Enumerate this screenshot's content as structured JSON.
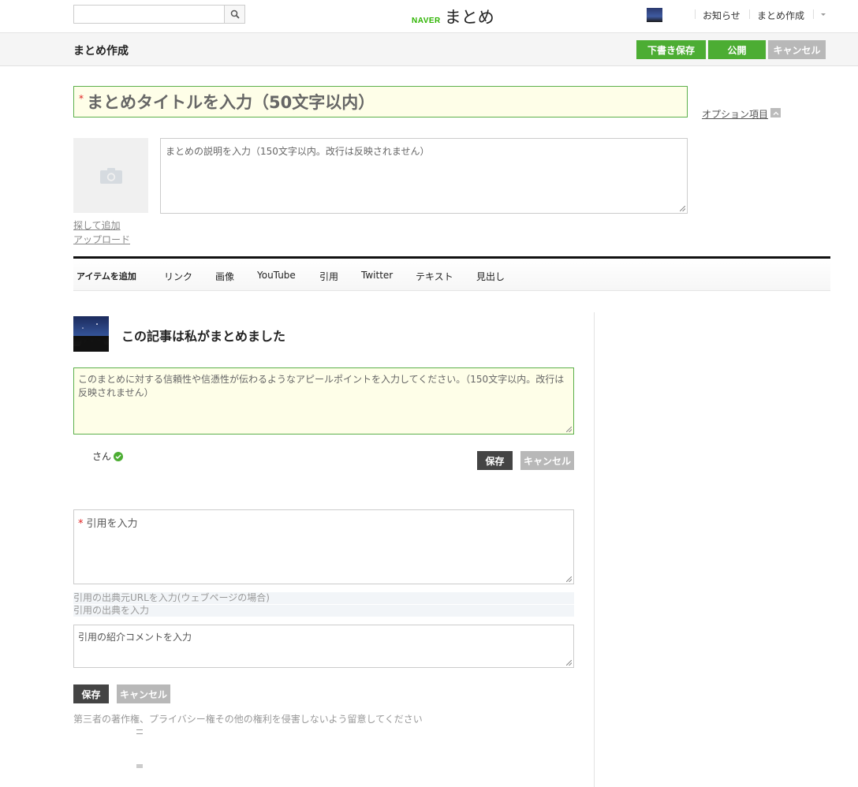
{
  "header": {
    "search_placeholder": "",
    "logo_brand": "NAVER",
    "logo_service": "まとめ",
    "links": [
      "お知らせ",
      "まとめ作成"
    ]
  },
  "subheader": {
    "title": "まとめ作成",
    "draft_label": "下書き保存",
    "publish_label": "公開",
    "cancel_label": "キャンセル"
  },
  "editor": {
    "required_mark": "*",
    "title_placeholder": "まとめタイトルを入力（50文字以内）",
    "option_label": "オプション項目",
    "description_placeholder": "まとめの説明を入力（150文字以内。改行は反映されません）",
    "search_add": "探して追加",
    "upload": "アップロード"
  },
  "items_toolbar": {
    "label": "アイテムを追加",
    "tabs": [
      "リンク",
      "画像",
      "YouTube",
      "引用",
      "Twitter",
      "テキスト",
      "見出し"
    ]
  },
  "curator": {
    "heading": "この記事は私がまとめました",
    "appeal_placeholder": "このまとめに対する信頼性や信憑性が伝わるようなアピールポイントを入力してください。（150文字以内。改行は反映されません）",
    "name_suffix": "さん",
    "save_label": "保存",
    "cancel_label": "キャンセル"
  },
  "quote": {
    "required_mark": "*",
    "quote_placeholder": "引用を入力",
    "url_placeholder": "引用の出典元URLを入力(ウェブページの場合)",
    "source_placeholder": "引用の出典を入力",
    "comment_placeholder": "引用の紹介コメントを入力",
    "save_label": "保存",
    "cancel_label": "キャンセル",
    "notice": "第三者の著作権、プライバシー権その他の権利を侵害しないよう留意してください"
  },
  "colors": {
    "accent_green": "#4cad33",
    "required_red": "#e02020",
    "input_highlight": "#fefee8"
  }
}
